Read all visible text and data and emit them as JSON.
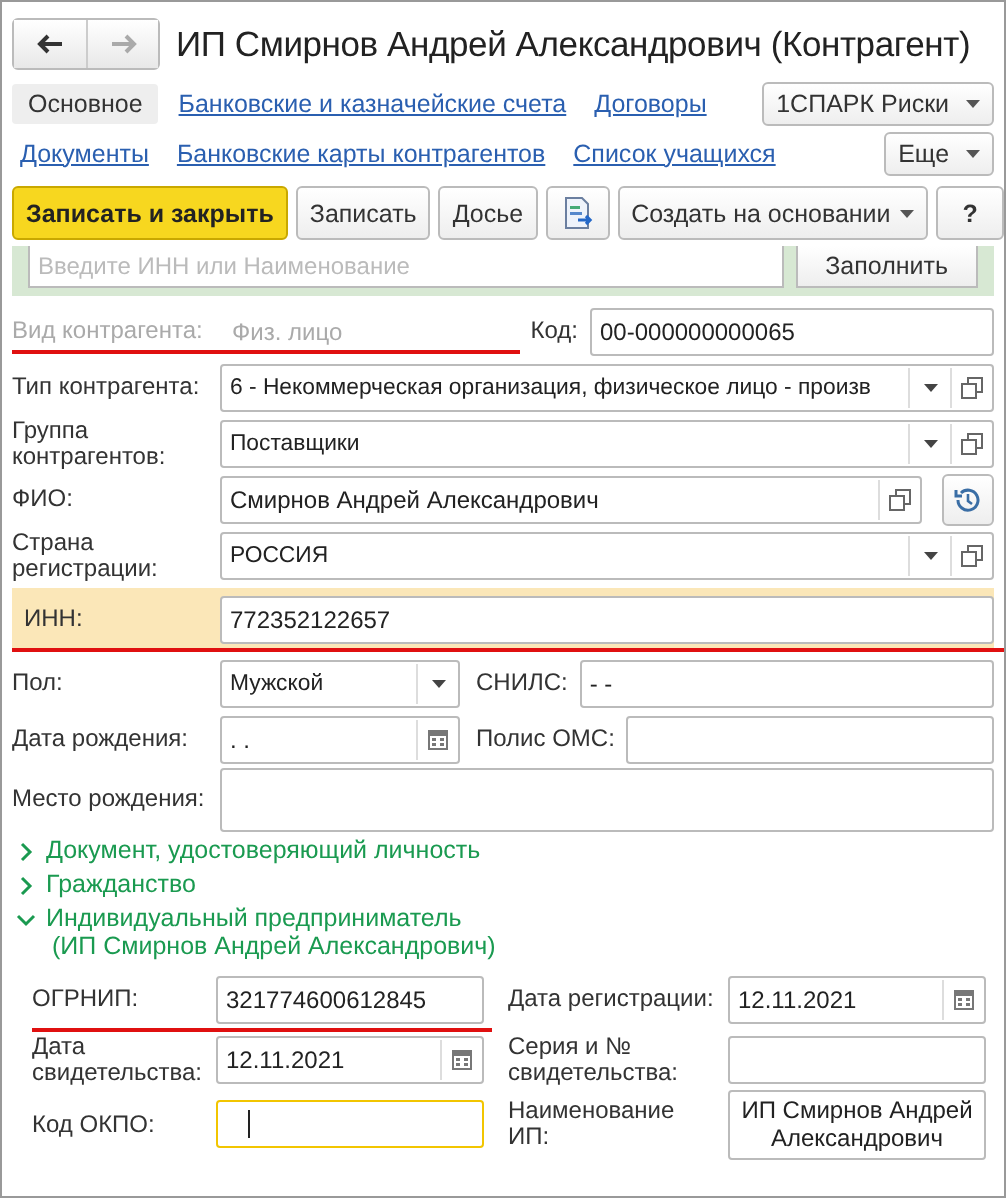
{
  "window": {
    "title": "ИП Смирнов Андрей Александрович (Контрагент)"
  },
  "nav": [
    {
      "kind": "back",
      "disabled": false
    },
    {
      "kind": "forward",
      "disabled": true
    }
  ],
  "tab_rows": [
    [
      {
        "label": "Основное",
        "selected": true
      },
      {
        "label": "Банковские и казначейские счета",
        "selected": false
      },
      {
        "label": "Договоры",
        "selected": false
      }
    ],
    [
      {
        "label": "Документы",
        "selected": false
      },
      {
        "label": "Банковские карты контрагентов",
        "selected": false
      },
      {
        "label": "Список учащихся",
        "selected": false
      }
    ]
  ],
  "menu_buttons": [
    "1СПАРК Риски",
    "Еще"
  ],
  "toolbar": [
    {
      "kind": "primary",
      "label": "Записать и закрыть"
    },
    {
      "kind": "button",
      "label": "Записать"
    },
    {
      "kind": "button",
      "label": "Досье"
    },
    {
      "kind": "icon"
    },
    {
      "kind": "dropdown",
      "label": "Создать на основании"
    },
    {
      "kind": "button",
      "label": "?"
    }
  ],
  "search": {
    "placeholder": "Введите ИНН или Наименование",
    "button": "Заполнить"
  },
  "rows": [
    {
      "cells": [
        {
          "kind": "static",
          "label": "Вид контрагента:",
          "value": "Физ. лицо",
          "underlined": true
        },
        {
          "kind": "text",
          "label": "Код:",
          "value": "00-000000000065"
        }
      ]
    },
    {
      "cells": [
        {
          "kind": "select",
          "label": "Тип контрагента:",
          "value": "6 - Некоммерческая организация, физическое лицо - произв",
          "open": true
        }
      ]
    },
    {
      "cells": [
        {
          "kind": "select",
          "label": "Группа контрагентов:",
          "value": "Поставщики",
          "open": true
        }
      ]
    },
    {
      "cells": [
        {
          "kind": "text",
          "label": "ФИО:",
          "value": "Смирнов Андрей Александрович",
          "open": true,
          "history_button": true
        }
      ]
    },
    {
      "cells": [
        {
          "kind": "select",
          "label": "Страна регистрации:",
          "value": "РОССИЯ",
          "open": true
        }
      ]
    },
    {
      "highlighted": true,
      "cells": [
        {
          "kind": "text",
          "label": "ИНН:",
          "value": "772352122657",
          "underlined": true
        }
      ]
    },
    {
      "cells": [
        {
          "kind": "select",
          "label": "Пол:",
          "value": "Мужской"
        },
        {
          "kind": "text",
          "label": "СНИЛС:",
          "value": "-  -"
        }
      ]
    },
    {
      "cells": [
        {
          "kind": "date",
          "label": "Дата рождения:",
          "value": ".  ."
        },
        {
          "kind": "text",
          "label": "Полис ОМС:"
        }
      ]
    },
    {
      "cells": [
        {
          "kind": "textarea",
          "label": "Место рождения:"
        }
      ]
    }
  ],
  "groups": [
    {
      "title_lines": [
        "Документ, удостоверяющий личность"
      ],
      "expanded": false
    },
    {
      "title_lines": [
        "Гражданство"
      ],
      "expanded": false
    },
    {
      "title_lines": [
        "Индивидуальный предприниматель",
        "(ИП Смирнов Андрей Александрович)"
      ],
      "expanded": true,
      "rows": [
        {
          "cells": [
            {
              "kind": "text",
              "label": "ОГРНИП:",
              "value": "321774600612845",
              "underlined": true
            },
            {
              "kind": "date",
              "label": "Дата регистрации:",
              "value": "12.11.2021"
            }
          ]
        },
        {
          "cells": [
            {
              "kind": "date",
              "label": "Дата свидетельства:",
              "value": "12.11.2021"
            },
            {
              "kind": "text",
              "label": "Серия и № свидетельства:"
            }
          ]
        },
        {
          "cells": [
            {
              "kind": "text",
              "label": "Код ОКПО:",
              "focused": true
            },
            {
              "kind": "multiline",
              "label": "Наименование ИП:",
              "value": "ИП Смирнов Андрей Александрович"
            }
          ]
        }
      ]
    }
  ]
}
